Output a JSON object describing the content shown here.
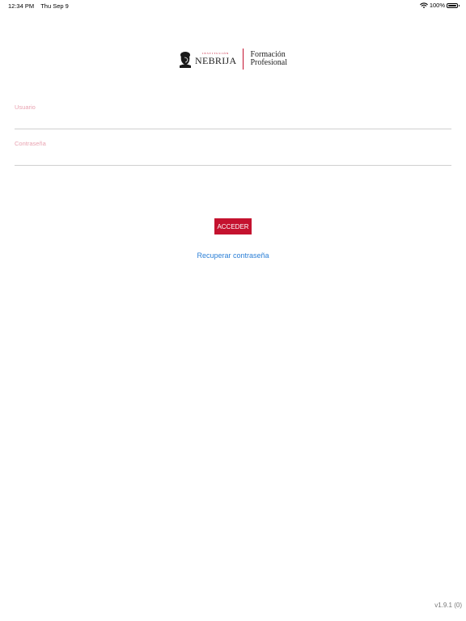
{
  "status_bar": {
    "time": "12:34 PM",
    "date": "Thu Sep 9",
    "battery": "100%",
    "battery_level": 1.0,
    "icons": [
      "wifi-icon",
      "battery-icon"
    ]
  },
  "logo": {
    "supertitle": "INSTITUCIÓN",
    "brand": "NEBRIJA",
    "line1": "Formación",
    "line2": "Profesional",
    "colors": {
      "accent": "#c4122f",
      "text": "#222222"
    }
  },
  "form": {
    "user_label": "Usuario",
    "password_label": "Contraseña",
    "user_value": "",
    "password_value": ""
  },
  "actions": {
    "login_label": "ACCEDER",
    "recover_label": "Recuperar contraseña"
  },
  "footer": {
    "version": "v1.9.1 (0)"
  },
  "colors": {
    "primary": "#c4122f",
    "link": "#2b7fd6",
    "label": "#e9a3b1",
    "underline": "#cfcfcf"
  }
}
